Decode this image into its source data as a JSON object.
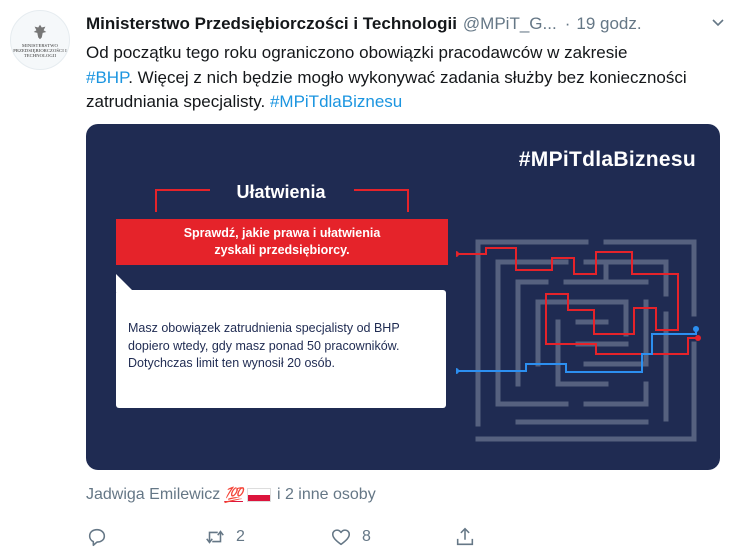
{
  "tweet": {
    "avatar_label": "MINISTERSTWO PRZEDSIĘBIORCZOŚCI I TECHNOLOGII",
    "author_name": "Ministerstwo Przedsiębiorczości i Technologii",
    "handle": "@MPiT_G...",
    "separator": "·",
    "time": "19 godz.",
    "text_1": "Od początku tego roku ograniczono obowiązki pracodawców w zakresie",
    "hashtag_bhp": "#BHP",
    "text_2": ". Więcej z nich będzie mogło wykonywać zadania służby bez konieczności zatrudniania specjalisty. ",
    "hashtag_mpit": "#MPiTdlaBiznesu"
  },
  "card": {
    "hashtag": "#MPiTdlaBiznesu",
    "title": "Ułatwienia",
    "red_text_1": "Sprawdź, jakie prawa i ułatwienia",
    "red_text_2": "zyskali przedsiębiorcy.",
    "body_1": "Masz obowiązek zatrudnienia specjalisty od BHP",
    "body_2": "dopiero wtedy, gdy masz ponad 50 pracowników.",
    "body_3": "Dotychczas limit ten wynosił 20 osób.",
    "bg_color": "#1f2b52",
    "red_color": "#e5232a"
  },
  "social": {
    "liked_by": "Jadwiga Emilewicz",
    "emoji": "💯",
    "others": "i 2 inne osoby"
  },
  "actions": {
    "reply_icon": "reply-icon",
    "retweet_count": "2",
    "like_count": "8",
    "share_icon": "share-icon"
  }
}
